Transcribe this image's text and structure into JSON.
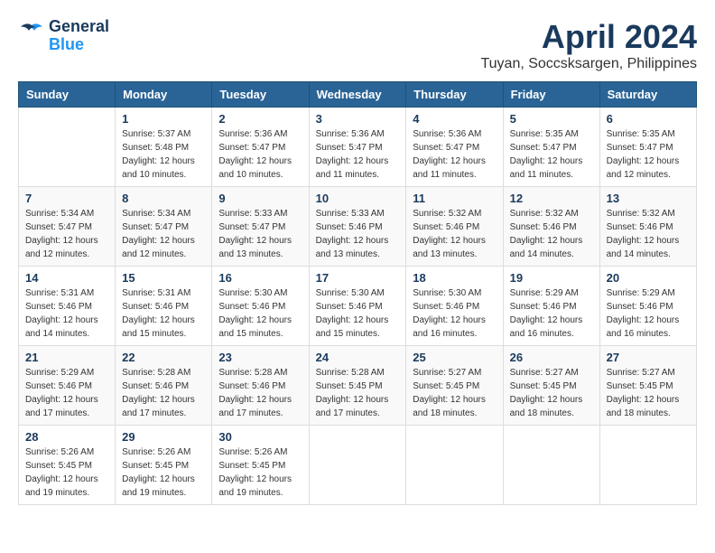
{
  "header": {
    "logo_line1": "General",
    "logo_line2": "Blue",
    "month": "April 2024",
    "location": "Tuyan, Soccsksargen, Philippines"
  },
  "weekdays": [
    "Sunday",
    "Monday",
    "Tuesday",
    "Wednesday",
    "Thursday",
    "Friday",
    "Saturday"
  ],
  "weeks": [
    [
      {
        "day": "",
        "info": ""
      },
      {
        "day": "1",
        "info": "Sunrise: 5:37 AM\nSunset: 5:48 PM\nDaylight: 12 hours\nand 10 minutes."
      },
      {
        "day": "2",
        "info": "Sunrise: 5:36 AM\nSunset: 5:47 PM\nDaylight: 12 hours\nand 10 minutes."
      },
      {
        "day": "3",
        "info": "Sunrise: 5:36 AM\nSunset: 5:47 PM\nDaylight: 12 hours\nand 11 minutes."
      },
      {
        "day": "4",
        "info": "Sunrise: 5:36 AM\nSunset: 5:47 PM\nDaylight: 12 hours\nand 11 minutes."
      },
      {
        "day": "5",
        "info": "Sunrise: 5:35 AM\nSunset: 5:47 PM\nDaylight: 12 hours\nand 11 minutes."
      },
      {
        "day": "6",
        "info": "Sunrise: 5:35 AM\nSunset: 5:47 PM\nDaylight: 12 hours\nand 12 minutes."
      }
    ],
    [
      {
        "day": "7",
        "info": "Sunrise: 5:34 AM\nSunset: 5:47 PM\nDaylight: 12 hours\nand 12 minutes."
      },
      {
        "day": "8",
        "info": "Sunrise: 5:34 AM\nSunset: 5:47 PM\nDaylight: 12 hours\nand 12 minutes."
      },
      {
        "day": "9",
        "info": "Sunrise: 5:33 AM\nSunset: 5:47 PM\nDaylight: 12 hours\nand 13 minutes."
      },
      {
        "day": "10",
        "info": "Sunrise: 5:33 AM\nSunset: 5:46 PM\nDaylight: 12 hours\nand 13 minutes."
      },
      {
        "day": "11",
        "info": "Sunrise: 5:32 AM\nSunset: 5:46 PM\nDaylight: 12 hours\nand 13 minutes."
      },
      {
        "day": "12",
        "info": "Sunrise: 5:32 AM\nSunset: 5:46 PM\nDaylight: 12 hours\nand 14 minutes."
      },
      {
        "day": "13",
        "info": "Sunrise: 5:32 AM\nSunset: 5:46 PM\nDaylight: 12 hours\nand 14 minutes."
      }
    ],
    [
      {
        "day": "14",
        "info": "Sunrise: 5:31 AM\nSunset: 5:46 PM\nDaylight: 12 hours\nand 14 minutes."
      },
      {
        "day": "15",
        "info": "Sunrise: 5:31 AM\nSunset: 5:46 PM\nDaylight: 12 hours\nand 15 minutes."
      },
      {
        "day": "16",
        "info": "Sunrise: 5:30 AM\nSunset: 5:46 PM\nDaylight: 12 hours\nand 15 minutes."
      },
      {
        "day": "17",
        "info": "Sunrise: 5:30 AM\nSunset: 5:46 PM\nDaylight: 12 hours\nand 15 minutes."
      },
      {
        "day": "18",
        "info": "Sunrise: 5:30 AM\nSunset: 5:46 PM\nDaylight: 12 hours\nand 16 minutes."
      },
      {
        "day": "19",
        "info": "Sunrise: 5:29 AM\nSunset: 5:46 PM\nDaylight: 12 hours\nand 16 minutes."
      },
      {
        "day": "20",
        "info": "Sunrise: 5:29 AM\nSunset: 5:46 PM\nDaylight: 12 hours\nand 16 minutes."
      }
    ],
    [
      {
        "day": "21",
        "info": "Sunrise: 5:29 AM\nSunset: 5:46 PM\nDaylight: 12 hours\nand 17 minutes."
      },
      {
        "day": "22",
        "info": "Sunrise: 5:28 AM\nSunset: 5:46 PM\nDaylight: 12 hours\nand 17 minutes."
      },
      {
        "day": "23",
        "info": "Sunrise: 5:28 AM\nSunset: 5:46 PM\nDaylight: 12 hours\nand 17 minutes."
      },
      {
        "day": "24",
        "info": "Sunrise: 5:28 AM\nSunset: 5:45 PM\nDaylight: 12 hours\nand 17 minutes."
      },
      {
        "day": "25",
        "info": "Sunrise: 5:27 AM\nSunset: 5:45 PM\nDaylight: 12 hours\nand 18 minutes."
      },
      {
        "day": "26",
        "info": "Sunrise: 5:27 AM\nSunset: 5:45 PM\nDaylight: 12 hours\nand 18 minutes."
      },
      {
        "day": "27",
        "info": "Sunrise: 5:27 AM\nSunset: 5:45 PM\nDaylight: 12 hours\nand 18 minutes."
      }
    ],
    [
      {
        "day": "28",
        "info": "Sunrise: 5:26 AM\nSunset: 5:45 PM\nDaylight: 12 hours\nand 19 minutes."
      },
      {
        "day": "29",
        "info": "Sunrise: 5:26 AM\nSunset: 5:45 PM\nDaylight: 12 hours\nand 19 minutes."
      },
      {
        "day": "30",
        "info": "Sunrise: 5:26 AM\nSunset: 5:45 PM\nDaylight: 12 hours\nand 19 minutes."
      },
      {
        "day": "",
        "info": ""
      },
      {
        "day": "",
        "info": ""
      },
      {
        "day": "",
        "info": ""
      },
      {
        "day": "",
        "info": ""
      }
    ]
  ]
}
